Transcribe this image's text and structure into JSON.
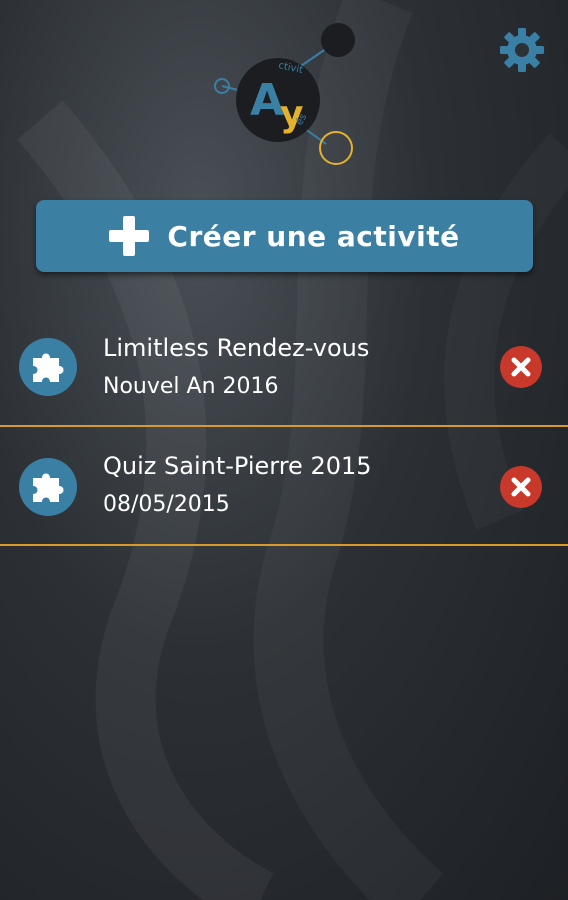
{
  "logo": {
    "letters_a": "A",
    "letters_y": "y",
    "text_top": "ctivit",
    "text_bottom": "és"
  },
  "settings": {
    "icon": "gear-icon"
  },
  "create_button": {
    "label": "Créer une activité",
    "icon": "plus-icon"
  },
  "activities": [
    {
      "title": "Limitless Rendez-vous",
      "subtitle": "Nouvel An 2016",
      "icon": "puzzle-icon",
      "delete_icon": "close-icon"
    },
    {
      "title": "Quiz Saint-Pierre 2015",
      "subtitle": "08/05/2015",
      "icon": "puzzle-icon",
      "delete_icon": "close-icon"
    }
  ],
  "colors": {
    "accent_blue": "#3b7fa3",
    "separator_orange": "#d79a2b",
    "delete_red": "#c8392b",
    "logo_yellow": "#e4b12c",
    "background_dark": "#2c3035"
  }
}
